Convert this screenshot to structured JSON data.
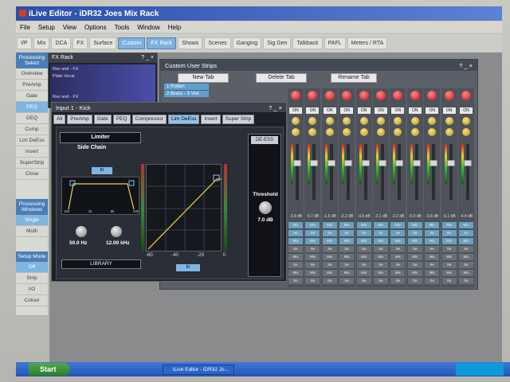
{
  "window": {
    "title": "iLive Editor - iDR32 Joes Mix Rack"
  },
  "menu": [
    "File",
    "Setup",
    "View",
    "Options",
    "Tools",
    "Window",
    "Help"
  ],
  "toolbar": [
    "I/P",
    "Mix",
    "DCA",
    "FX",
    "Surface",
    "Custom",
    "FX Rack",
    "Shows",
    "Scenes",
    "Ganging",
    "Sig Gen",
    "Talkback",
    "PAFL",
    "Meters / RTA"
  ],
  "toolbar_active": [
    "Custom",
    "FX Rack"
  ],
  "sidebar": {
    "processing_select": "Processing Select",
    "items": [
      "Overview",
      "PreAmp",
      "Gate",
      "PEQ",
      "GEQ",
      "Comp",
      "Lim DeEss",
      "Insert",
      "SuperStrip",
      "Close"
    ],
    "selected": "PEQ",
    "processing_windows": "Processing Windows",
    "windows_items": [
      "Single",
      "Multi"
    ],
    "setup_mode": "Setup Mode",
    "setup_items": [
      "Off",
      "Strip",
      "I/O",
      "Colour"
    ]
  },
  "fx_rack": {
    "title": "FX Rack",
    "lines": [
      "Rev and - FX",
      "Plate Vocal",
      "Rev and - FX"
    ]
  },
  "custom_user_strips": {
    "title": "Custom User Strips",
    "new_tab": "New Tab",
    "delete_tab": "Delete Tab",
    "rename_tab": "Rename Tab",
    "user_tabs": [
      "1 Rotten",
      "2 Brass - 3 Vox"
    ],
    "strip_count": 11,
    "on_label": "ON",
    "level_labels": [
      "-3.9 dB",
      "-5.7 dB",
      "-1.6 dB",
      "-2.2 dB",
      "-3.5 dB",
      "-3.1 dB",
      "-2.2 dB",
      "-5.0 dB",
      "-3.8 dB",
      "-6.1 dB",
      "-4.4 dB"
    ],
    "cell_labels": [
      "Mix",
      "Se"
    ]
  },
  "input_window": {
    "title": "Input 1 - Kick",
    "tabs": [
      "All",
      "PreAmp",
      "Gate",
      "PEQ",
      "Compressor",
      "Lim DeEss",
      "Insert",
      "Super Strip"
    ],
    "active_tab": "Lim DeEss",
    "limiter_label": "Limiter",
    "side_chain_label": "Side Chain",
    "side_chain_in": "In",
    "hz_value": "50.0 Hz",
    "khz_value": "12.00 kHz",
    "library": "LIBRARY",
    "graph_x_ticks": [
      "-60",
      "-40",
      "-20",
      "0"
    ],
    "graph_in": "In",
    "sc_ticks": [
      "100",
      "1k",
      "5k",
      "10k"
    ],
    "deess_title": "DE-ESS",
    "threshold_label": "Threshold",
    "threshold_value": "7.0 dB"
  },
  "taskbar": {
    "start": "Start",
    "task": "iLive Editor - iDR32 Jo..."
  }
}
